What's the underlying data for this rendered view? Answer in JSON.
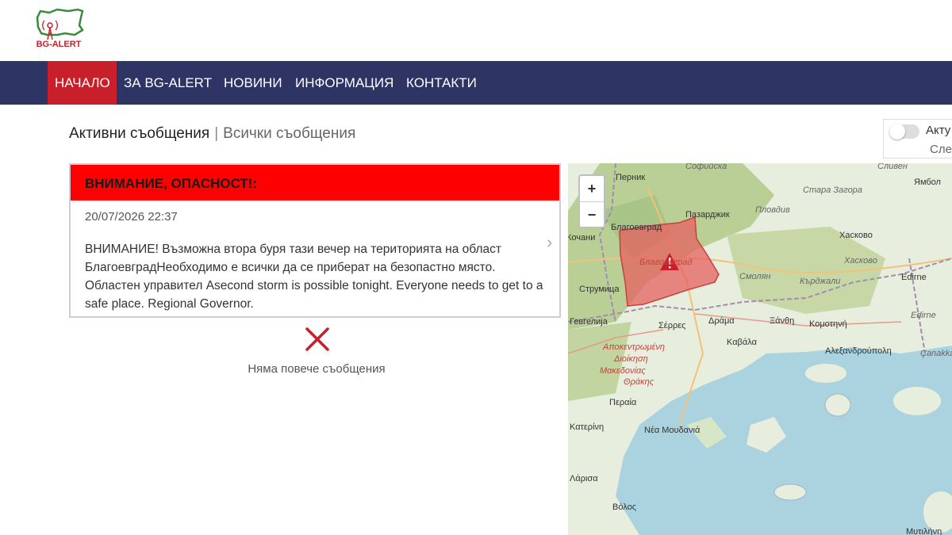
{
  "logo": {
    "text": "BG-ALERT"
  },
  "nav": [
    {
      "label": "НАЧАЛО",
      "active": true
    },
    {
      "label": "ЗА BG-ALERT",
      "active": false
    },
    {
      "label": "НОВИНИ",
      "active": false
    },
    {
      "label": "ИНФОРМАЦИЯ",
      "active": false
    },
    {
      "label": "КОНТАКТИ",
      "active": false
    }
  ],
  "tabs": {
    "active": "Активни съобщения",
    "separator": "|",
    "other": "Всички съобщения"
  },
  "toggle": {
    "label": "Акту",
    "sub": "Сле",
    "on": false
  },
  "alert": {
    "title": "ВНИМАНИЕ, ОПАСНОСТ!:",
    "date": "20/07/2026 22:37",
    "body": "ВНИМАНИЕ! Възможна втора буря тази вечер на територията на област БлагоевградНеобходимо е всички да се приберат на безопастно място. Областен управител Asecond storm is possible tonight. Everyone needs to get to a safe place. Regional Governor.",
    "arrow": "›"
  },
  "no_more": {
    "text": "Няма повече съобщения"
  },
  "map": {
    "zoom_in": "+",
    "zoom_out": "−",
    "labels": [
      {
        "text": "Перник",
        "style": ""
      },
      {
        "text": "Софийска",
        "style": "i"
      },
      {
        "text": "Сливен",
        "style": "i"
      },
      {
        "text": "Ямбол",
        "style": ""
      },
      {
        "text": "Стара Загора",
        "style": "i"
      },
      {
        "text": "Пазарджик",
        "style": ""
      },
      {
        "text": "Пловдив",
        "style": "i"
      },
      {
        "text": "Хасково",
        "style": ""
      },
      {
        "text": "Кочани",
        "style": ""
      },
      {
        "text": "Благоевград",
        "style": ""
      },
      {
        "text": "Благоевград",
        "style": "red"
      },
      {
        "text": "Хасково",
        "style": "i"
      },
      {
        "text": "Смолян",
        "style": "i"
      },
      {
        "text": "Кърджали",
        "style": "i"
      },
      {
        "text": "Edirne",
        "style": ""
      },
      {
        "text": "Струмица",
        "style": ""
      },
      {
        "text": "Гевгелија",
        "style": ""
      },
      {
        "text": "Σέρρες",
        "style": ""
      },
      {
        "text": "Δράμα",
        "style": ""
      },
      {
        "text": "Ξάνθη",
        "style": ""
      },
      {
        "text": "Κομοτηνή",
        "style": ""
      },
      {
        "text": "Edirne",
        "style": "i"
      },
      {
        "text": "Καβάλα",
        "style": ""
      },
      {
        "text": "Αλεξανδρούπολη",
        "style": ""
      },
      {
        "text": "Αποκεντρωμένη",
        "style": "red"
      },
      {
        "text": "Διοίκηση",
        "style": "red"
      },
      {
        "text": "Μακεδονίας",
        "style": "red"
      },
      {
        "text": "Θράκης",
        "style": "red"
      },
      {
        "text": "Περαία",
        "style": ""
      },
      {
        "text": "Κατερίνη",
        "style": ""
      },
      {
        "text": "Νέα Μουδανιά",
        "style": ""
      },
      {
        "text": "Çanakkale",
        "style": "i"
      },
      {
        "text": "Λάρισα",
        "style": ""
      },
      {
        "text": "Βόλος",
        "style": ""
      },
      {
        "text": "Μυτιλήνη",
        "style": ""
      },
      {
        "text": "Ямбол",
        "style": "i"
      }
    ]
  },
  "colors": {
    "nav_bg": "#2e3463",
    "active": "#c8202a",
    "alert_red": "#ff0000",
    "region": "#e66060"
  }
}
